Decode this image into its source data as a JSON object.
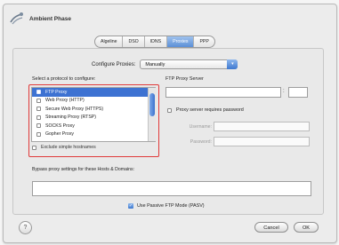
{
  "header": {
    "title": "Ambient Phase"
  },
  "tabs": [
    "Algeline",
    "DSO",
    "IDNS",
    "Proxies",
    "PPP"
  ],
  "configure": {
    "label": "Configure Proxies:",
    "value": "Manually"
  },
  "protocols": {
    "label": "Select a protocol to configure:",
    "items": [
      {
        "label": "FTP Proxy",
        "selected": true
      },
      {
        "label": "Web Proxy (HTTP)",
        "selected": false
      },
      {
        "label": "Secure Web Proxy (HTTPS)",
        "selected": false
      },
      {
        "label": "Streaming Proxy (RTSP)",
        "selected": false
      },
      {
        "label": "SOCKS Proxy",
        "selected": false
      },
      {
        "label": "Gopher Proxy",
        "selected": false
      }
    ],
    "exclude_label": "Exclude simple hostnames"
  },
  "server": {
    "label": "FTP Proxy Server",
    "value": "",
    "port": "",
    "password_label": "Proxy server requires password",
    "username_label": "Username:",
    "password_field_label": "Password:"
  },
  "bypass": {
    "label": "Bypass proxy settings for these Hosts & Domains:",
    "value": ""
  },
  "passive": {
    "label": "Use Passive FTP Mode (PASV)"
  },
  "buttons": {
    "help": "?",
    "cancel": "Cancel",
    "ok": "OK"
  },
  "colors": {
    "accent": "#3d72d2",
    "highlight": "#e03a3a"
  }
}
